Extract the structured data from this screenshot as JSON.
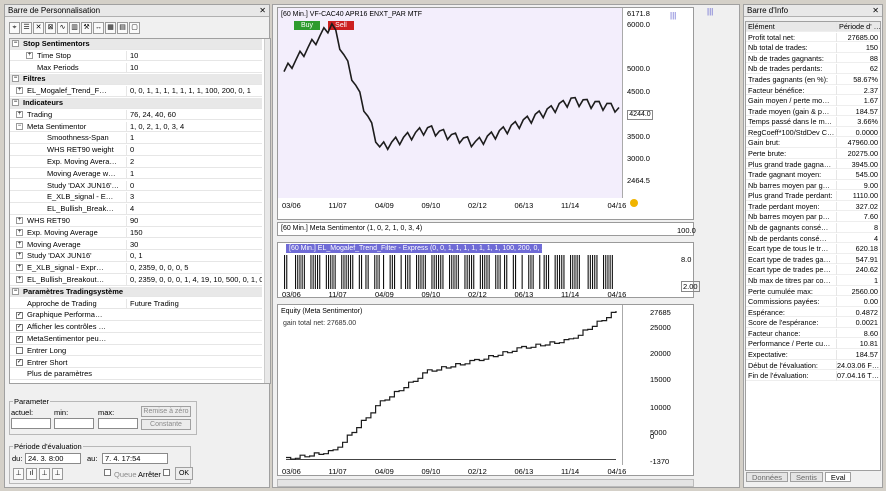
{
  "left_panel": {
    "title": "Barre de Personnalisation",
    "toolbar_icons": [
      "select-icon",
      "list-icon",
      "cross-icon",
      "chart-icon",
      "line-icon",
      "bars-icon",
      "tool-icon",
      "ruler-icon",
      "grid-icon",
      "table-icon",
      "window-icon"
    ],
    "tree": [
      {
        "type": "header",
        "label": "Stop Sentimentors",
        "expander": "⊟"
      },
      {
        "type": "item",
        "indent": 1,
        "expander": "⊞",
        "label": "Time Stop",
        "value": "10"
      },
      {
        "type": "item",
        "indent": 1,
        "label": "Max Periods",
        "value": "10"
      },
      {
        "type": "header",
        "label": "Filtres",
        "expander": "⊟"
      },
      {
        "type": "item",
        "indent": 0,
        "expander": "⊞",
        "label": "EL_Mogalef_Trend_F…",
        "value": "0, 0, 1, 1, 1, 1, 1, 1, 1, 100, 200, 0, 1"
      },
      {
        "type": "header",
        "label": "Indicateurs",
        "expander": "⊟"
      },
      {
        "type": "item",
        "indent": 0,
        "expander": "⊞",
        "label": "Trading",
        "value": "76, 24, 40, 60"
      },
      {
        "type": "item",
        "indent": 0,
        "expander": "⊟",
        "label": "Meta Sentimentor",
        "value": "1, 0, 2, 1, 0, 3, 4"
      },
      {
        "type": "item",
        "indent": 2,
        "label": "Smoothness-Span",
        "value": "1"
      },
      {
        "type": "item",
        "indent": 2,
        "label": "WHS RET90 weight",
        "value": "0"
      },
      {
        "type": "item",
        "indent": 2,
        "label": "Exp. Moving Avera…",
        "value": "2"
      },
      {
        "type": "item",
        "indent": 2,
        "label": "Moving Average w…",
        "value": "1"
      },
      {
        "type": "item",
        "indent": 2,
        "label": "Study 'DAX JUN16'…",
        "value": "0"
      },
      {
        "type": "item",
        "indent": 2,
        "label": "E_XLB_signal - E…",
        "value": "3"
      },
      {
        "type": "item",
        "indent": 2,
        "label": "EL_Bullish_Break…",
        "value": "4"
      },
      {
        "type": "item",
        "indent": 0,
        "expander": "⊞",
        "label": "WHS RET90",
        "value": "90"
      },
      {
        "type": "item",
        "indent": 0,
        "expander": "⊞",
        "label": "Exp. Moving Average",
        "value": "150"
      },
      {
        "type": "item",
        "indent": 0,
        "expander": "⊞",
        "label": "Moving Average",
        "value": "30"
      },
      {
        "type": "item",
        "indent": 0,
        "expander": "⊞",
        "label": "Study 'DAX JUN16'",
        "value": "0, 1"
      },
      {
        "type": "item",
        "indent": 0,
        "expander": "⊞",
        "label": "E_XLB_signal - Expr…",
        "value": "0, 2359, 0, 0, 0, 5"
      },
      {
        "type": "item",
        "indent": 0,
        "expander": "⊞",
        "label": "EL_Bullish_Breakout…",
        "value": "0, 2359, 0, 0, 0, 1, 4, 19, 10, 500, 0, 1, 0"
      },
      {
        "type": "header",
        "label": "Paramètres Tradingsystème",
        "expander": "⊟"
      },
      {
        "type": "item",
        "indent": 0,
        "label": "Approche de Trading",
        "value": "Future Trading"
      },
      {
        "type": "check",
        "checked": true,
        "label": "Graphique Performa…",
        "value": ""
      },
      {
        "type": "check",
        "checked": true,
        "label": "Afficher les contrôles …",
        "value": ""
      },
      {
        "type": "check",
        "checked": true,
        "label": "MetaSentimentor peu…",
        "value": ""
      },
      {
        "type": "check",
        "checked": false,
        "label": "Entrer Long",
        "value": ""
      },
      {
        "type": "check",
        "checked": true,
        "label": "Entrer Short",
        "value": ""
      },
      {
        "type": "item",
        "indent": 0,
        "label": "Plus de paramètres",
        "value": ""
      }
    ],
    "parameter": {
      "group_label": "Parameter",
      "actual_label": "actuel:",
      "min_label": "min:",
      "max_label": "max:",
      "reset_button": "Remise à zéro",
      "constant_button": "Constante"
    },
    "evaluation": {
      "group_label": "Période d'évaluation",
      "from_label": "du:",
      "from_value": "24. 3.   8:00",
      "to_label": "au:",
      "to_value": "7. 4.  17:54",
      "queue_label": "Queue",
      "stop_label": "Arrêter",
      "ok_button": "OK"
    }
  },
  "center_panel": {
    "price_chart": {
      "header": "[60 Min.] VF-CAC40 APR16        ENXT_PAR MTF",
      "buy_label": "Buy",
      "sell_label": "Sell",
      "last_price": "4244.0",
      "y_ticks": [
        "6171.8",
        "6000.0",
        "5000.0",
        "4500.0",
        "4000.0",
        "3500.0",
        "3000.0",
        "2464.5"
      ],
      "x_ticks": [
        "03/06",
        "11/07",
        "04/09",
        "09/10",
        "02/12",
        "06/13",
        "11/14",
        "04/16"
      ]
    },
    "meta_chart": {
      "header": "[60 Min.] Meta Sentimentor  (1, 0, 2, 1, 0, 3, 4)",
      "y_ticks": [
        "100.0"
      ]
    },
    "filter_chart": {
      "header": "[60 Min.] EL_Mogalef_Trend_Filter - Express  (0, 0, 1, 1, 1, 1, 1, 1, 1, 100, 200, 0, 1)",
      "y_ticks": [
        "8.0",
        "2.00"
      ],
      "x_ticks": [
        "03/06",
        "11/07",
        "04/09",
        "09/10",
        "02/12",
        "06/13",
        "11/14",
        "04/16"
      ]
    },
    "equity_chart": {
      "header": "Equity  (Meta Sentimentor)",
      "gain_label": "gain total net: 27685.00",
      "y_ticks": [
        "27685",
        "25000",
        "20000",
        "15000",
        "10000",
        "5000",
        "0",
        "-1370"
      ],
      "x_ticks": [
        "03/06",
        "11/07",
        "04/09",
        "09/10",
        "02/12",
        "06/13",
        "11/14",
        "04/16"
      ]
    },
    "colors": {
      "buy": "#2e9b2e",
      "sell": "#cc2020",
      "chart_bg": "#f3eefc",
      "filter_header": "#6f6bd6"
    }
  },
  "chart_data": [
    {
      "type": "line",
      "title": "[60 Min.] VF-CAC40 APR16",
      "x": [
        "03/06",
        "11/07",
        "04/09",
        "09/10",
        "02/12",
        "06/13",
        "11/14",
        "04/16"
      ],
      "series": [
        {
          "values": [
            5000,
            6000,
            3400,
            3800,
            3500,
            3950,
            4400,
            4244
          ]
        }
      ],
      "ylim": [
        2464.5,
        6171.8
      ]
    },
    {
      "type": "line",
      "title": "Equity  (Meta Sentimentor)",
      "x": [
        "03/06",
        "11/07",
        "04/09",
        "09/10",
        "02/12",
        "06/13",
        "11/14",
        "04/16"
      ],
      "series": [
        {
          "values": [
            -1000,
            500,
            10000,
            16000,
            18000,
            20500,
            22000,
            27685
          ]
        }
      ],
      "ylim": [
        -1370,
        27685
      ]
    }
  ],
  "right_panel": {
    "title": "Barre d'Info",
    "col_element": "Elément",
    "col_period": "Période d' …",
    "rows": [
      [
        "Profit total net:",
        "27685.00"
      ],
      [
        "Nb total de trades:",
        "150"
      ],
      [
        "Nb de trades gagnants:",
        "88"
      ],
      [
        "Nb de trades perdants:",
        "62"
      ],
      [
        "Trades gagnants (en %):",
        "58.67%"
      ],
      [
        "Facteur bénéfice:",
        "2.37"
      ],
      [
        "Gain moyen / perte mo…",
        "1.67"
      ],
      [
        "Trade moyen (gain & p…",
        "184.57"
      ],
      [
        "Temps passé dans le m…",
        "3.66%"
      ],
      [
        "RegCoeff*100/StdDev C…",
        "0.0000"
      ],
      [
        "Gain brut:",
        "47960.00"
      ],
      [
        "Perte brute:",
        "20275.00"
      ],
      [
        "Plus grand trade gagna…",
        "3945.00"
      ],
      [
        "Trade gagnant moyen:",
        "545.00"
      ],
      [
        "Nb barres moyen par g…",
        "9.00"
      ],
      [
        "Plus grand Trade perdant:",
        "1110.00"
      ],
      [
        "Trade perdant moyen:",
        "327.02"
      ],
      [
        "Nb barres moyen par p…",
        "7.60"
      ],
      [
        "Nb de gagnants consé…",
        "8"
      ],
      [
        "Nb de perdants consé…",
        "4"
      ],
      [
        "Ecart type de tous le tr…",
        "620.18"
      ],
      [
        "Ecart type de trades ga…",
        "547.91"
      ],
      [
        "Ecart type de trades pe…",
        "240.62"
      ],
      [
        "Nb max de titres par co…",
        "1"
      ],
      [
        "Perte cumulée max:",
        "2560.00"
      ],
      [
        "Commissions payées:",
        "0.00"
      ],
      [
        "Espérance:",
        "0.4872"
      ],
      [
        "Score de l'espérance:",
        "0.0021"
      ],
      [
        "Facteur chance:",
        "8.60"
      ],
      [
        "Performance / Perte cu…",
        "10.81"
      ],
      [
        "Expectative:",
        "184.57"
      ],
      [
        "Début de l'évaluation:",
        "24.03.06 F…"
      ],
      [
        "Fin de l'évaluation:",
        "07.04.16 T…"
      ]
    ],
    "tabs": [
      {
        "label": "Données",
        "active": false
      },
      {
        "label": "Sentis",
        "active": false
      },
      {
        "label": "Eval",
        "active": true
      }
    ]
  }
}
